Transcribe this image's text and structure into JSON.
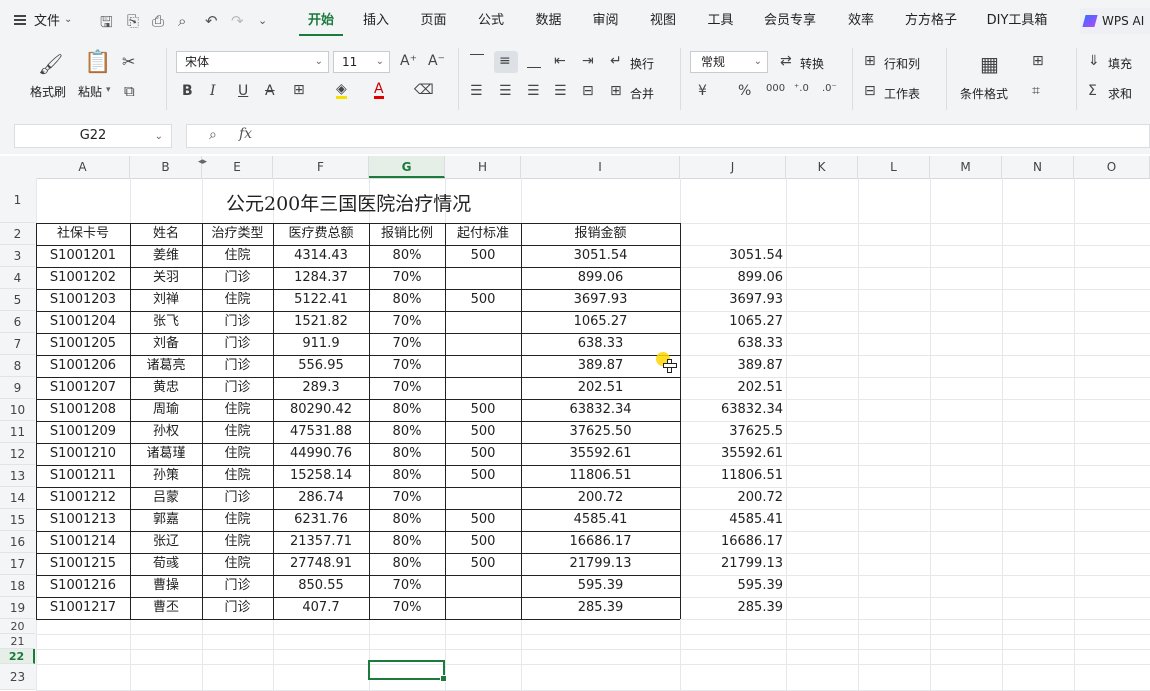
{
  "menu": {
    "file": "文件",
    "tabs": [
      "开始",
      "插入",
      "页面",
      "公式",
      "数据",
      "审阅",
      "视图",
      "工具",
      "会员专享",
      "效率",
      "方方格子",
      "DIY工具箱"
    ],
    "active_tab": "开始",
    "ai_button": "WPS AI"
  },
  "ribbon": {
    "format_painter": "格式刷",
    "paste": "粘贴",
    "font_name": "宋体",
    "font_size": "11",
    "wrap": "换行",
    "merge": "合并",
    "number_format": "常规",
    "convert": "转换",
    "row_col": "行和列",
    "worksheet": "工作表",
    "conditional_format": "条件格式",
    "fill": "填充",
    "sum": "求和",
    "bold": "B",
    "italic": "I",
    "underline": "U",
    "strike": "A",
    "currency": "¥",
    "percent": "%",
    "thousand": "000"
  },
  "formula_bar": {
    "name_box": "G22",
    "fx": "fx",
    "value": ""
  },
  "columns": [
    "A",
    "B",
    "E",
    "F",
    "G",
    "H",
    "I",
    "J",
    "K",
    "L",
    "M",
    "N",
    "O"
  ],
  "selected_column": "G",
  "rows": [
    "1",
    "2",
    "3",
    "4",
    "5",
    "6",
    "7",
    "8",
    "9",
    "10",
    "11",
    "12",
    "13",
    "14",
    "15",
    "16",
    "17",
    "18",
    "19",
    "20",
    "21",
    "22",
    "23"
  ],
  "selected_row": "22",
  "sheet": {
    "title": "公元200年三国医院治疗情况",
    "headers": [
      "社保卡号",
      "姓名",
      "治疗类型",
      "医疗费总额",
      "报销比例",
      "起付标准",
      "报销金额"
    ],
    "data": [
      [
        "S1001201",
        "姜维",
        "住院",
        "4314.43",
        "80%",
        "500",
        "3051.54",
        "3051.54"
      ],
      [
        "S1001202",
        "关羽",
        "门诊",
        "1284.37",
        "70%",
        "",
        "899.06",
        "899.06"
      ],
      [
        "S1001203",
        "刘禅",
        "住院",
        "5122.41",
        "80%",
        "500",
        "3697.93",
        "3697.93"
      ],
      [
        "S1001204",
        "张飞",
        "门诊",
        "1521.82",
        "70%",
        "",
        "1065.27",
        "1065.27"
      ],
      [
        "S1001205",
        "刘备",
        "门诊",
        "911.9",
        "70%",
        "",
        "638.33",
        "638.33"
      ],
      [
        "S1001206",
        "诸葛亮",
        "门诊",
        "556.95",
        "70%",
        "",
        "389.87",
        "389.87"
      ],
      [
        "S1001207",
        "黄忠",
        "门诊",
        "289.3",
        "70%",
        "",
        "202.51",
        "202.51"
      ],
      [
        "S1001208",
        "周瑜",
        "住院",
        "80290.42",
        "80%",
        "500",
        "63832.34",
        "63832.34"
      ],
      [
        "S1001209",
        "孙权",
        "住院",
        "47531.88",
        "80%",
        "500",
        "37625.50",
        "37625.5"
      ],
      [
        "S1001210",
        "诸葛瑾",
        "住院",
        "44990.76",
        "80%",
        "500",
        "35592.61",
        "35592.61"
      ],
      [
        "S1001211",
        "孙策",
        "住院",
        "15258.14",
        "80%",
        "500",
        "11806.51",
        "11806.51"
      ],
      [
        "S1001212",
        "吕蒙",
        "门诊",
        "286.74",
        "70%",
        "",
        "200.72",
        "200.72"
      ],
      [
        "S1001213",
        "郭嘉",
        "住院",
        "6231.76",
        "80%",
        "500",
        "4585.41",
        "4585.41"
      ],
      [
        "S1001214",
        "张辽",
        "住院",
        "21357.71",
        "80%",
        "500",
        "16686.17",
        "16686.17"
      ],
      [
        "S1001215",
        "荀彧",
        "住院",
        "27748.91",
        "80%",
        "500",
        "21799.13",
        "21799.13"
      ],
      [
        "S1001216",
        "曹操",
        "门诊",
        "850.55",
        "70%",
        "",
        "595.39",
        "595.39"
      ],
      [
        "S1001217",
        "曹丕",
        "门诊",
        "407.7",
        "70%",
        "",
        "285.39",
        "285.39"
      ]
    ]
  }
}
